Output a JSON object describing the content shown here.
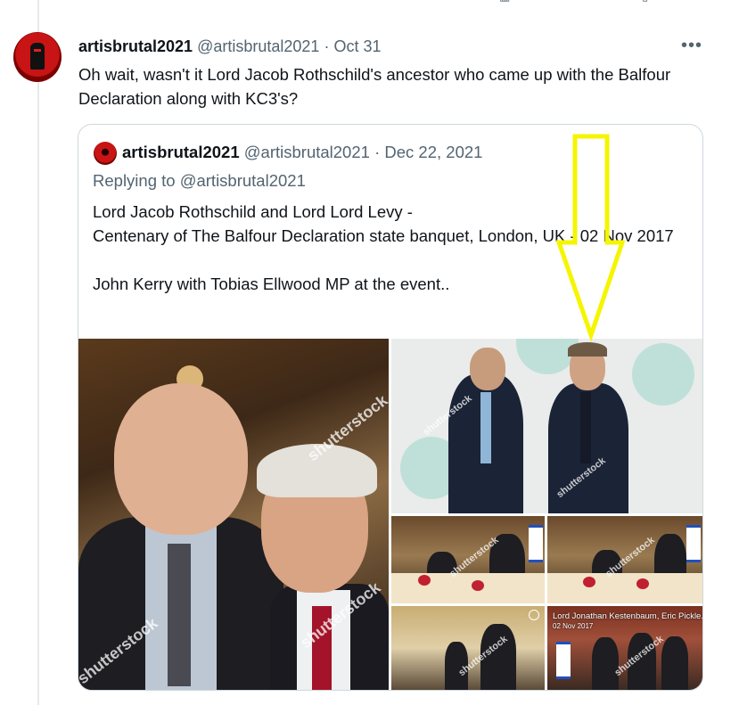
{
  "tweet": {
    "display_name": "artisbrutal2021",
    "handle": "@artisbrutal2021",
    "separator": "·",
    "date": "Oct 31",
    "text": "Oh wait, wasn't it Lord Jacob Rothschild's ancestor who came up with the Balfour Declaration along with KC3's?",
    "more_icon": "more-horizontal-icon"
  },
  "quoted": {
    "display_name": "artisbrutal2021",
    "handle": "@artisbrutal2021",
    "separator": "·",
    "date": "Dec 22, 2021",
    "replying_prefix": "Replying to",
    "replying_to": "@artisbrutal2021",
    "line1": "Lord Jacob Rothschild and Lord Lord Levy -",
    "line2": "Centenary of The Balfour Declaration state banquet, London, UK - 02 Nov 2017",
    "line3": "John Kerry with Tobias Ellwood MP at the event..",
    "watermark": "shutterstock",
    "caption_name": "Lord Jonathan Kestenbaum, Eric Pickle...",
    "caption_date": "02 Nov 2017"
  },
  "annotation": {
    "type": "yellow-arrow-pointing-down",
    "color": "#f5f500"
  },
  "colors": {
    "text": "#0f1419",
    "secondary": "#536471",
    "border": "#cfd9de"
  }
}
